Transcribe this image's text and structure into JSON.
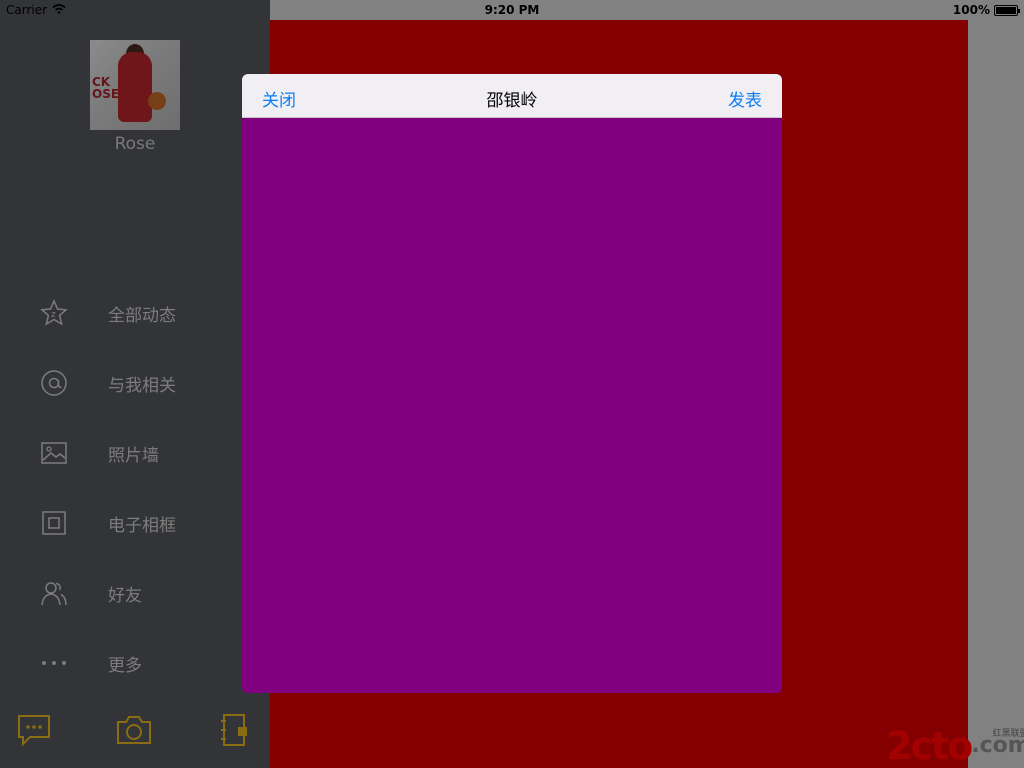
{
  "status_bar": {
    "carrier": "Carrier",
    "time": "9:20 PM",
    "battery": "100%"
  },
  "sidebar": {
    "username": "Rose",
    "avatar_text": "CK\nOSE",
    "menu": [
      {
        "label": "全部动态",
        "icon": "star-icon"
      },
      {
        "label": "与我相关",
        "icon": "at-icon"
      },
      {
        "label": "照片墙",
        "icon": "photo-icon"
      },
      {
        "label": "电子相框",
        "icon": "frame-icon"
      },
      {
        "label": "好友",
        "icon": "friends-icon"
      },
      {
        "label": "更多",
        "icon": "more-icon"
      }
    ],
    "bottom_icons": [
      "message-icon",
      "camera-icon",
      "notebook-icon"
    ]
  },
  "modal": {
    "left_button": "关闭",
    "title": "邵银岭",
    "right_button": "发表"
  },
  "watermark": {
    "brand": "2cto",
    "dot_com": ".com",
    "sub": "红黑联盟"
  },
  "colors": {
    "sidebar": "#56585c",
    "main": "#dc0000",
    "modal_body": "#800080",
    "accent": "#0a7ef5",
    "toolbar_icon": "#c79a1c"
  }
}
